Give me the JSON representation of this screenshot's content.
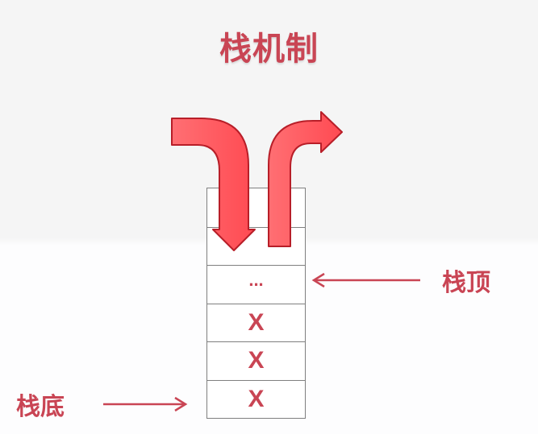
{
  "title": "栈机制",
  "stack": {
    "cells": [
      "",
      "",
      "...",
      "X",
      "X",
      "X"
    ]
  },
  "labels": {
    "top": "栈顶",
    "bottom": "栈底"
  },
  "colors": {
    "accent": "#c94554",
    "arrow_fill": "#ff5c61",
    "arrow_stroke": "#b81e28",
    "border": "#7f7f7f"
  }
}
